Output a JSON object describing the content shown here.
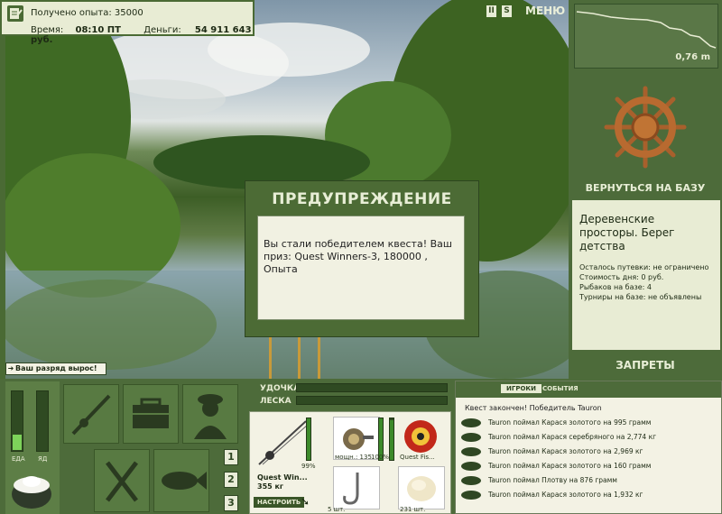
{
  "info": {
    "exp_text": "Получено опыта: 35000",
    "time_label": "Время:",
    "time_value": "08:10 ПТ",
    "money_label": "Деньги:",
    "money_value": "54 911 643 руб."
  },
  "topbar": {
    "pause_label": "II",
    "s_label": "S",
    "menu_label": "МЕНЮ"
  },
  "depth": {
    "value": "0,76 m"
  },
  "right": {
    "return_label": "ВЕРНУТЬСЯ НА БАЗУ",
    "location_title": "Деревенские просторы. Берег детства",
    "stats": [
      "Осталось путевки: не ограничено",
      "Стоимость дня: 0 руб.",
      "Рыбаков на базе: 4",
      "Турниры на базе: не объявлены"
    ],
    "bans_label": "ЗАПРЕТЫ"
  },
  "dialog": {
    "title": "ПРЕДУПРЕЖДЕНИЕ",
    "message": "Вы стали победителем квеста! Ваш приз: Quest Winners-3, 180000 , Опыта"
  },
  "notice": {
    "text": "Ваш разряд вырос!"
  },
  "status": {
    "food_label": "ЕДА",
    "poison_label": "ЯД",
    "food_level": 0.25,
    "poison_level": 0
  },
  "lines": {
    "rod_label": "УДОЧКА",
    "line_label": "ЛЕСКА"
  },
  "tackle": {
    "rod_name": "Quest Win...",
    "rod_weight": "355 кг",
    "rod_percent": "99%",
    "reel_power": "мощн.: 135",
    "reel_percent": "100%",
    "line_name": "Quest Fis...",
    "hooks_count": "5 шт.",
    "bait_count": "231 шт.",
    "setup_label": "НАСТРОИТЬ"
  },
  "pages": [
    "1",
    "2",
    "3"
  ],
  "events": {
    "tab_players": "ИГРОКИ",
    "tab_events": "СОБЫТИЯ",
    "headline": "Квест закончен! Победитель Tauron",
    "items": [
      "Tauron поймал Карася золотого на 995 грамм",
      "Tauron поймал Карася серебряного на 2,774 кг",
      "Tauron поймал Карася золотого на 2,969 кг",
      "Tauron поймал Карася золотого на 160 грамм",
      "Tauron поймал Плотву на 876 грамм",
      "Tauron поймал Карася золотого на 1,932 кг"
    ]
  },
  "colors": {
    "panel_green": "#4d6b3a",
    "panel_light": "#e8ecd4",
    "accent_text": "#e9eed9"
  }
}
